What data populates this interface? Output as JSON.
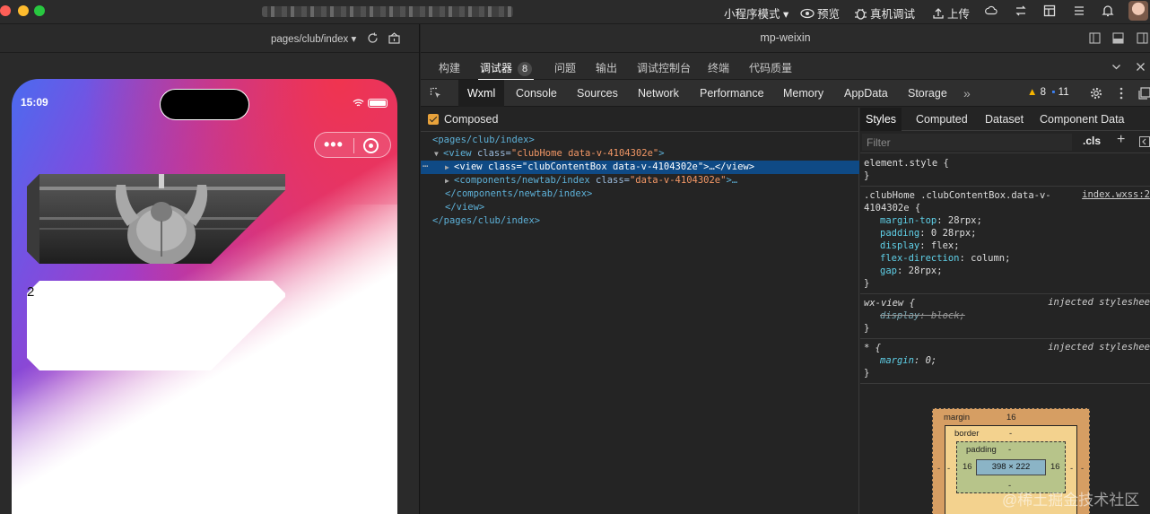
{
  "titlebar": {
    "mode": "小程序模式 ▾",
    "preview": "预览",
    "device_debug": "真机调试",
    "upload": "上传"
  },
  "simulator": {
    "path": "pages/club/index ▾",
    "time": "15:09",
    "card_text": "2"
  },
  "devtools": {
    "title": "mp-weixin",
    "tabs": [
      "构建",
      "调试器",
      "问题",
      "输出",
      "调试控制台",
      "终端",
      "代码质量"
    ],
    "debugger_badge": "8",
    "panels": [
      "Wxml",
      "Console",
      "Sources",
      "Network",
      "Performance",
      "Memory",
      "AppData",
      "Storage"
    ],
    "more": "»",
    "warnings": "8",
    "infos": "11",
    "composed_label": "Composed",
    "tree": {
      "l1_tag": "<pages/club/index>",
      "l2_open": "<view ",
      "l2_attr": "class=",
      "l2_val": "\"clubHome data-v-4104302e\"",
      "l2_close": ">",
      "l3_open": "<view ",
      "l3_attr": "class=",
      "l3_val": "\"clubContentBox data-v-4104302e\"",
      "l3_close": ">…</view>",
      "l4_open": "<components/newtab/index ",
      "l4_attr": "class=",
      "l4_val": "\"data-v-4104302e\"",
      "l4_close": ">…",
      "l5": "</components/newtab/index>",
      "l6": "</view>",
      "l7": "</pages/club/index>",
      "ellipsis": "…"
    },
    "styles_tabs": [
      "Styles",
      "Computed",
      "Dataset",
      "Component Data"
    ],
    "filter_placeholder": "Filter",
    "cls": ".cls",
    "plus": "+",
    "rules": {
      "element_style": "element.style {",
      "close": "}",
      "club_sel1": ".clubHome .clubContentBox.data-v-",
      "club_sel2": "4104302e {",
      "club_src": "index.wxss:2",
      "p1": "margin-top",
      "v1": "28rpx;",
      "p2": "padding",
      "v2": "0 28rpx;",
      "p3": "display",
      "v3": "flex;",
      "p4": "flex-direction",
      "v4": "column;",
      "p5": "gap",
      "v5": "28rpx;",
      "wx_sel": "wx-view {",
      "injected": "injected styleshee",
      "wx_p": "display",
      "wx_v": "block;",
      "star_sel": "* {",
      "star_p": "margin",
      "star_v": "0;"
    },
    "boxmodel": {
      "margin_label": "margin",
      "margin_top": "16",
      "border_label": "border",
      "border_val": "-",
      "padding_label": "padding",
      "padding_val": "-",
      "content": "398 × 222",
      "side_left": "16",
      "side_right": "16",
      "dash": "-"
    }
  },
  "watermark": "@稀土掘金技术社区"
}
